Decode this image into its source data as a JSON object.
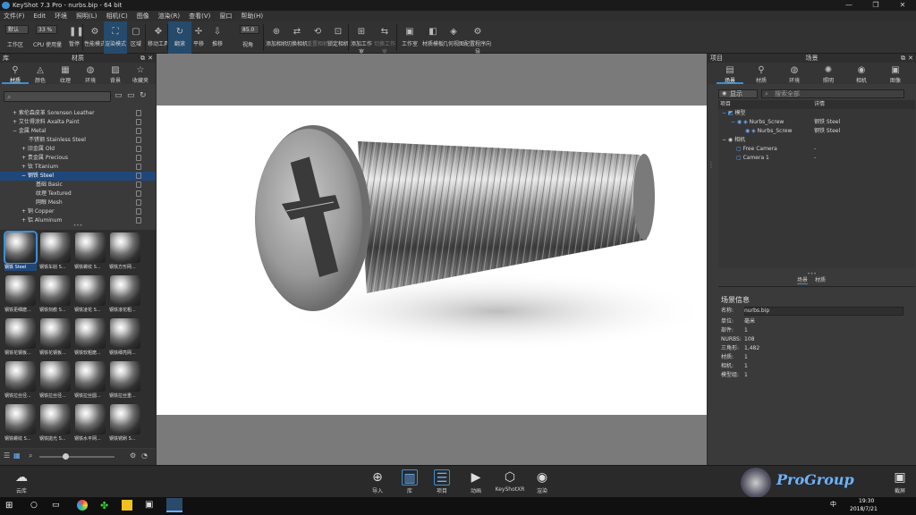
{
  "window": {
    "title": "KeyShot 7.3 Pro  -  nurbs.bip  -  64 bit",
    "controls": [
      "—",
      "❐",
      "✕"
    ]
  },
  "menu": [
    "文件(F)",
    "Edit",
    "环境",
    "照明(L)",
    "相机(C)",
    "图像",
    "渲染(R)",
    "查看(V)",
    "窗口",
    "帮助(H)"
  ],
  "toolbar": {
    "preset_value": "默认",
    "cpu_value": "33 %",
    "zoom_value": "85.0",
    "buttons": [
      "工作区",
      "CPU 使用量",
      "暂停",
      "性能模式",
      "渲染模式",
      "区域",
      "移动工具",
      "翻滚",
      "平移",
      "推移",
      "视角",
      "添加相机",
      "切换相机",
      "重置相机",
      "锁定相机",
      "添加工作室",
      "切换工作室",
      "工作室",
      "材质模板",
      "几何视图",
      "配置程序向导"
    ]
  },
  "library": {
    "header_left": "库",
    "header": "材质",
    "tabs": [
      "材质",
      "颜色",
      "纹理",
      "环境",
      "背景",
      "收藏夹"
    ],
    "tree": [
      {
        "label": "+ 索伦森皮革 Sorensen Leather",
        "indent": 0
      },
      {
        "label": "+ 艾仕得涂料 Axalta Paint",
        "indent": 0
      },
      {
        "label": "− 金属 Metal",
        "indent": 0
      },
      {
        "label": "不锈钢 Stainless Steel",
        "indent": 2
      },
      {
        "label": "+ 旧金属 Old",
        "indent": 1
      },
      {
        "label": "+ 贵金属 Precious",
        "indent": 1
      },
      {
        "label": "+ 钛 Titanium",
        "indent": 1
      },
      {
        "label": "− 钢铁 Steel",
        "indent": 1,
        "selected": true
      },
      {
        "label": "基础 Basic",
        "indent": 3
      },
      {
        "label": "纹理 Textured",
        "indent": 3
      },
      {
        "label": "网眼 Mesh",
        "indent": 3
      },
      {
        "label": "+ 铜 Copper",
        "indent": 1
      },
      {
        "label": "+ 铝 Aluminum",
        "indent": 1
      }
    ],
    "thumbs": [
      "钢铁 Steel",
      "钢铁车削 S...",
      "钢铁螺纹 S...",
      "钢铁方形网...",
      "钢铁更细磨...",
      "钢铁刻痕 S...",
      "钢铁凌花 S...",
      "钢铁滚花粗...",
      "钢铁花钢板...",
      "钢铁花钢板...",
      "钢铁较粗磨...",
      "钢铁细亮网...",
      "钢铁拉丝径...",
      "钢铁拉丝径...",
      "钢铁拉丝圆...",
      "钢铁拉丝重...",
      "钢铁螺纹 S...",
      "钢铁拋光 S...",
      "钢铁水平网...",
      "钢铁锈刷 S..."
    ]
  },
  "project": {
    "header_left": "项目",
    "header": "场景",
    "tabs": [
      "场景",
      "材质",
      "环境",
      "照明",
      "相机",
      "图像"
    ],
    "show_label": "显示",
    "search_placeholder": "搜索全部",
    "col_item": "项目",
    "col_detail": "详情",
    "tree": [
      {
        "label": "模型",
        "detail": "",
        "indent": 0
      },
      {
        "label": "Nurbs_Screw",
        "detail": "钢铁 Steel",
        "indent": 1
      },
      {
        "label": "Nurbs_Screw",
        "detail": "钢铁 Steel",
        "indent": 2
      },
      {
        "label": "相机",
        "detail": "",
        "indent": 0
      },
      {
        "label": "Free Camera",
        "detail": "-",
        "indent": 1
      },
      {
        "label": "Camera 1",
        "detail": "-",
        "indent": 1
      }
    ],
    "subtabs": [
      "场景",
      "材质"
    ],
    "info_title": "场景信息",
    "info": [
      {
        "k": "名称:",
        "v": "nurbs.bip"
      },
      {
        "k": "单位:",
        "v": "毫米"
      },
      {
        "k": "部件:",
        "v": "1"
      },
      {
        "k": "NURBS:",
        "v": "108"
      },
      {
        "k": "三角形:",
        "v": "1,482"
      },
      {
        "k": "材质:",
        "v": "1"
      },
      {
        "k": "相机:",
        "v": "1"
      },
      {
        "k": "模型组:",
        "v": "1"
      }
    ]
  },
  "bottom": {
    "cloud": "云库",
    "buttons": [
      "导入",
      "库",
      "项目",
      "动画",
      "KeyShotXR",
      "渲染"
    ],
    "right": "截屏"
  },
  "taskbar": {
    "time": "19:30",
    "date": "2018/7/21",
    "watermark": "ProGroup"
  }
}
